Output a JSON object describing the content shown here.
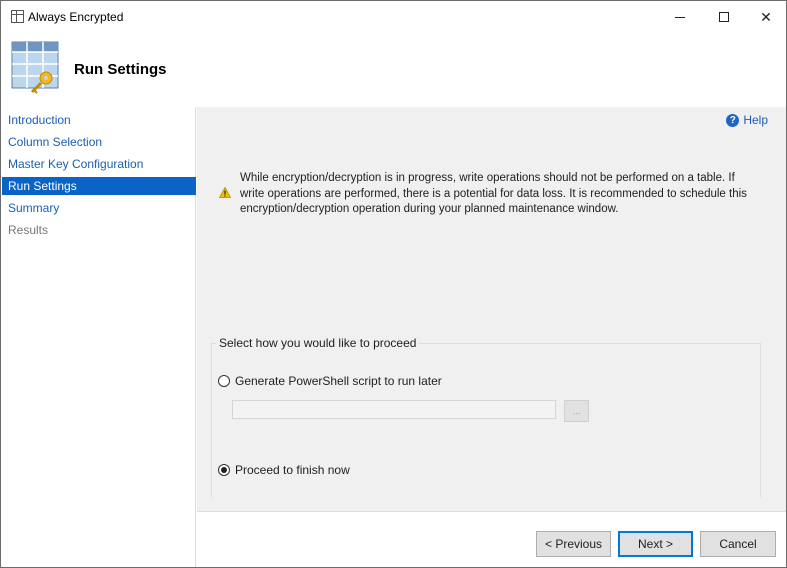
{
  "window": {
    "title": "Always Encrypted",
    "controls": {
      "minimize": "minimize",
      "maximize": "maximize",
      "close": "✕"
    }
  },
  "header": {
    "title": "Run Settings",
    "icon": "table-key-icon"
  },
  "sidebar": {
    "items": [
      {
        "label": "Introduction",
        "state": "link"
      },
      {
        "label": "Column Selection",
        "state": "link"
      },
      {
        "label": "Master Key Configuration",
        "state": "link"
      },
      {
        "label": "Run Settings",
        "state": "selected"
      },
      {
        "label": "Summary",
        "state": "link"
      },
      {
        "label": "Results",
        "state": "disabled"
      }
    ]
  },
  "help": {
    "label": "Help",
    "icon": "help-icon"
  },
  "warning": {
    "icon": "warning-icon",
    "text": "While encryption/decryption is in progress, write operations should not be performed on a table. If write operations are performed, there is a potential for data loss. It is recommended to schedule this encryption/decryption operation during your planned maintenance window."
  },
  "proceed": {
    "legend": "Select how you would like to proceed",
    "options": [
      {
        "label": "Generate PowerShell script to run later",
        "checked": false
      },
      {
        "label": "Proceed to finish now",
        "checked": true
      }
    ],
    "script_path": {
      "value": "",
      "placeholder": ""
    },
    "browse_label": "..."
  },
  "footer": {
    "previous": "< Previous",
    "next": "Next >",
    "cancel": "Cancel"
  },
  "colors": {
    "accent": "#0a64c8",
    "link": "#1a5fb4",
    "panel_bg": "#f0f0f0",
    "warning": "#f2c200"
  }
}
